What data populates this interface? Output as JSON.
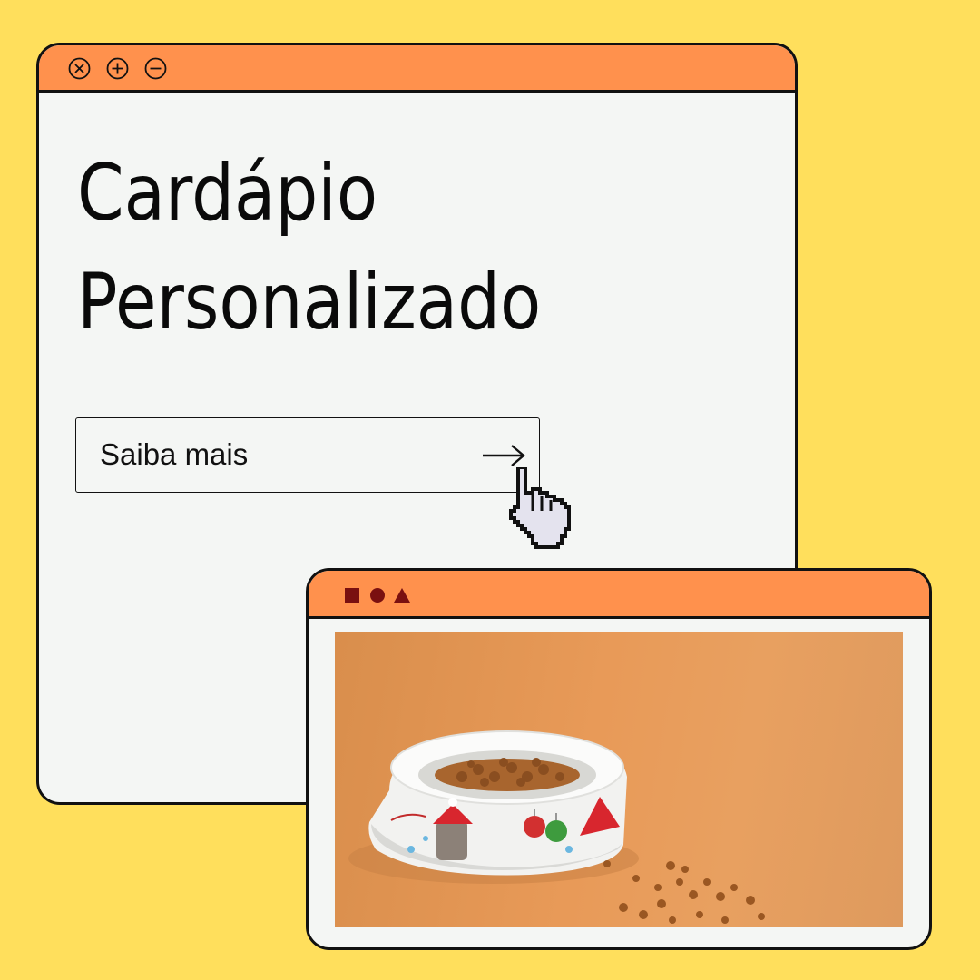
{
  "main_window": {
    "controls": [
      {
        "name": "close-icon"
      },
      {
        "name": "plus-icon"
      },
      {
        "name": "minus-icon"
      }
    ],
    "headline_line1": "Cardápio",
    "headline_line2": "Personalizado",
    "cta": {
      "label": "Saiba mais",
      "arrow_icon": "arrow-right-icon"
    },
    "cursor_icon": "hand-pointer-icon"
  },
  "image_window": {
    "title_shapes": [
      "square-icon",
      "circle-icon",
      "triangle-icon"
    ],
    "photo_icon": "pet-food-bowl-photo"
  },
  "colors": {
    "background": "#FFDF5C",
    "titlebar": "#FF914D",
    "window_body": "#F4F6F4",
    "border": "#111111",
    "shape_marks": "#7A1010",
    "photo_backdrop": "#E39A58"
  }
}
